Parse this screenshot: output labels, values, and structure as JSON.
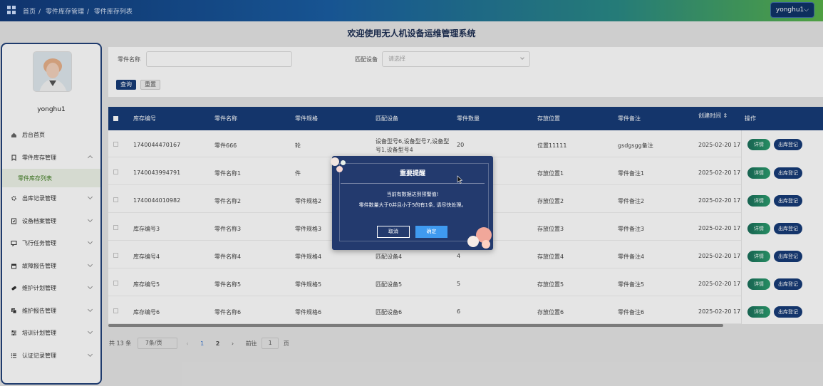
{
  "header": {
    "breadcrumb": [
      "首页",
      "零件库存管理",
      "零件库存列表"
    ],
    "user_button": "yonghu1⌵"
  },
  "page_title": "欢迎使用无人机设备运维管理系统",
  "sidebar": {
    "username": "yonghu1",
    "items": [
      {
        "label": "后台首页",
        "icon": "home-icon"
      },
      {
        "label": "零件库存管理",
        "icon": "bookmark-icon",
        "expanded": true
      },
      {
        "label": "零件库存列表",
        "sub": true
      },
      {
        "label": "出库记录管理",
        "icon": "gear-icon"
      },
      {
        "label": "设备档案管理",
        "icon": "clipboard-icon"
      },
      {
        "label": "飞行任务管理",
        "icon": "chat-icon"
      },
      {
        "label": "故障报告管理",
        "icon": "box-icon"
      },
      {
        "label": "维护计划管理",
        "icon": "tag-icon"
      },
      {
        "label": "维护报告管理",
        "icon": "doc-icon"
      },
      {
        "label": "培训计划管理",
        "icon": "sliders-icon"
      },
      {
        "label": "认证记录管理",
        "icon": "list-icon"
      }
    ]
  },
  "search": {
    "part_name_label": "零件名称",
    "part_name_value": "",
    "device_label": "匹配设备",
    "device_placeholder": "请选择",
    "query_button": "查询",
    "reset_button": "重置"
  },
  "table": {
    "headers": [
      "库存编号",
      "零件名称",
      "零件规格",
      "匹配设备",
      "零件数量",
      "存放位置",
      "零件备注",
      "创建时间 ⇕",
      "操作"
    ],
    "rows": [
      {
        "id": "1740044470167",
        "name": "零件666",
        "spec": "轮",
        "device1": "设备型号6,设备型号7,设备型",
        "device2": "号1,设备型号4",
        "qty": "20",
        "loc": "位置11111",
        "note": "gsdgsgg备注",
        "time": "2025-02-20 17:4"
      },
      {
        "id": "1740043994791",
        "name": "零件名称1",
        "spec": "件",
        "device1": "",
        "device2": "",
        "qty": "",
        "loc": "存放位置1",
        "note": "零件备注1",
        "time": "2025-02-20 17:3"
      },
      {
        "id": "1740044010982",
        "name": "零件名称2",
        "spec": "零件规格2",
        "device1": "",
        "device2": "",
        "qty": "",
        "loc": "存放位置2",
        "note": "零件备注2",
        "time": "2025-02-20 17:3"
      },
      {
        "id": "库存编号3",
        "name": "零件名称3",
        "spec": "零件规格3",
        "device1": "",
        "device2": "",
        "qty": "",
        "loc": "存放位置3",
        "note": "零件备注3",
        "time": "2025-02-20 17:3"
      },
      {
        "id": "库存编号4",
        "name": "零件名称4",
        "spec": "零件规格4",
        "device1": "匹配设备4",
        "device2": "",
        "qty": "4",
        "loc": "存放位置4",
        "note": "零件备注4",
        "time": "2025-02-20 17:3"
      },
      {
        "id": "库存编号5",
        "name": "零件名称5",
        "spec": "零件规格5",
        "device1": "匹配设备5",
        "device2": "",
        "qty": "5",
        "loc": "存放位置5",
        "note": "零件备注5",
        "time": "2025-02-20 17:3"
      },
      {
        "id": "库存编号6",
        "name": "零件名称6",
        "spec": "零件规格6",
        "device1": "匹配设备6",
        "device2": "",
        "qty": "6",
        "loc": "存放位置6",
        "note": "零件备注6",
        "time": "2025-02-20 17:3"
      }
    ],
    "detail_button": "详情",
    "out_button": "出库登记"
  },
  "pager": {
    "total": "共 13 条",
    "page_size": "7条/页",
    "prev": "‹",
    "page1": "1",
    "page2": "2",
    "next": "›",
    "goto_label": "前往",
    "goto_value": "1",
    "page_suffix": "页"
  },
  "dialog": {
    "title": "重要提醒",
    "message1": "当前有数据达到预警值!",
    "message2": "零件数量大于0并且小于5的有1条, 请尽快处理。",
    "cancel": "取消",
    "confirm": "确定"
  },
  "colors": {
    "primary": "#173c78",
    "accent": "#3f9af0",
    "dialog_bg": "#233a6e"
  }
}
